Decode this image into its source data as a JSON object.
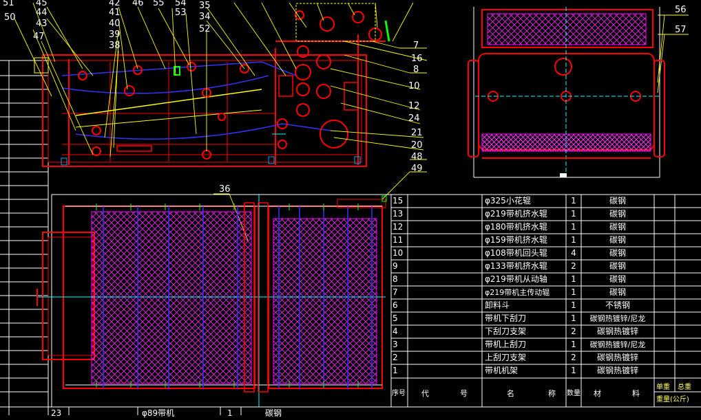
{
  "callouts_top": [
    "51",
    "45",
    "44",
    "43",
    "47",
    "50",
    "42",
    "41",
    "40",
    "39",
    "38",
    "46",
    "55",
    "54",
    "53",
    "52",
    "35",
    "34"
  ],
  "callouts_right_middle": [
    "7",
    "16",
    "8",
    "10",
    "12",
    "24",
    "21",
    "20",
    "48",
    "49"
  ],
  "callouts_side_view": [
    "56",
    "57"
  ],
  "callouts_plan": [
    "36"
  ],
  "bom_rows": [
    {
      "no": "15",
      "name": "φ325小花辊",
      "qty": "1",
      "material": "碳钢"
    },
    {
      "no": "13",
      "name": "φ219带机挤水辊",
      "qty": "1",
      "material": "碳钢"
    },
    {
      "no": "12",
      "name": "φ180带机挤水辊",
      "qty": "1",
      "material": "碳钢"
    },
    {
      "no": "11",
      "name": "φ159带机挤水辊",
      "qty": "1",
      "material": "碳钢"
    },
    {
      "no": "10",
      "name": "φ108带机回头辊",
      "qty": "4",
      "material": "碳钢"
    },
    {
      "no": "9",
      "name": "φ133带机挤水辊",
      "qty": "2",
      "material": "碳钢"
    },
    {
      "no": "8",
      "name": "φ219带机从动轴",
      "qty": "1",
      "material": "碳钢"
    },
    {
      "no": "7",
      "name": "φ219带机主传动辊",
      "qty": "1",
      "material": "碳钢"
    },
    {
      "no": "6",
      "name": "卸料斗",
      "qty": "1",
      "material": "不锈钢"
    },
    {
      "no": "5",
      "name": "带机下刮刀",
      "qty": "1",
      "material": "碳钢热镀锌/尼龙"
    },
    {
      "no": "4",
      "name": "下刮刀支架",
      "qty": "2",
      "material": "碳钢热镀锌"
    },
    {
      "no": "3",
      "name": "带机上刮刀",
      "qty": "1",
      "material": "碳钢热镀锌/尼龙"
    },
    {
      "no": "2",
      "name": "上刮刀支架",
      "qty": "2",
      "material": "碳钢热镀锌"
    },
    {
      "no": "1",
      "name": "带机机架",
      "qty": "1",
      "material": "碳钢热镀锌"
    }
  ],
  "bom_header": {
    "seq": "序号",
    "code_1": "代",
    "code_2": "号",
    "name_1": "名",
    "name_2": "称",
    "qty": "数量",
    "mat_1": "材",
    "mat_2": "料",
    "unit_weight": "单重",
    "total_weight": "总重",
    "weight_unit": "重量(公斤)"
  },
  "bottom_row": {
    "no": "23",
    "name": "φ89带机",
    "qty": "1",
    "material": "碳钢"
  },
  "colors": {
    "background": "#000000",
    "frame": "#ff0000",
    "dimension": "#ffffff",
    "leader": "#ffff00",
    "mesh": "#ff00ff",
    "axis": "#00ffff",
    "belt": "#0000ff"
  }
}
